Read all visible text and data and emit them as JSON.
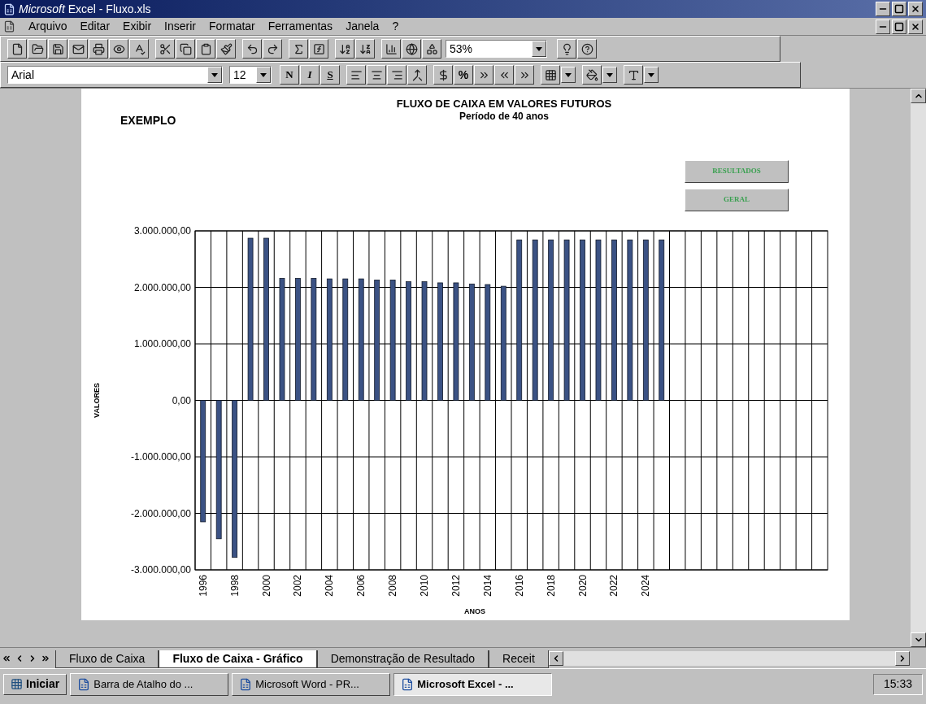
{
  "window": {
    "title": "*Microsoft* Excel - Fluxo.xls"
  },
  "menu": [
    "Arquivo",
    "Editar",
    "Exibir",
    "Inserir",
    "Formatar",
    "Ferramentas",
    "Janela",
    "?"
  ],
  "toolbar": {
    "zoom": "53%"
  },
  "format_toolbar": {
    "font": "Arial",
    "size": "12",
    "style_buttons": [
      "N",
      "I",
      "S"
    ],
    "percent": "%"
  },
  "chart": {
    "heading": "EXEMPLO",
    "buttons": [
      "RESULTADOS",
      "GERAL"
    ],
    "chart_data": {
      "type": "bar",
      "title": "FLUXO DE CAIXA EM VALORES FUTUROS",
      "subtitle": "Período de 40 anos",
      "xlabel": "ANOS",
      "ylabel": "VALORES",
      "x": [
        1996,
        1997,
        1998,
        1999,
        2000,
        2001,
        2002,
        2003,
        2004,
        2005,
        2006,
        2007,
        2008,
        2009,
        2010,
        2011,
        2012,
        2013,
        2014,
        2015,
        2016,
        2017,
        2018,
        2019,
        2020,
        2021,
        2022,
        2023,
        2024,
        2025
      ],
      "xlim": [
        1995.5,
        2035.5
      ],
      "grid": true,
      "series": [
        {
          "color": "#3b5284",
          "values": [
            -2150000,
            -2450000,
            -2780000,
            2870000,
            2870000,
            2160000,
            2160000,
            2160000,
            2150000,
            2150000,
            2150000,
            2130000,
            2130000,
            2100000,
            2100000,
            2080000,
            2080000,
            2060000,
            2050000,
            2020000,
            2840000,
            2840000,
            2840000,
            2840000,
            2840000,
            2840000,
            2840000,
            2840000,
            2840000,
            2840000
          ]
        }
      ],
      "ylim": [
        -3000000,
        3000000
      ],
      "yticks": [
        {
          "value": 3000000,
          "label": "3.000.000,00"
        },
        {
          "value": 2000000,
          "label": "2.000.000,00"
        },
        {
          "value": 1000000,
          "label": "1.000.000,00"
        },
        {
          "value": 0,
          "label": "0,00"
        },
        {
          "value": -1000000,
          "label": "-1.000.000,00"
        },
        {
          "value": -2000000,
          "label": "-2.000.000,00"
        },
        {
          "value": -3000000,
          "label": "-3.000.000,00"
        }
      ],
      "xticks": [
        1996,
        1998,
        2000,
        2002,
        2004,
        2006,
        2008,
        2010,
        2012,
        2014,
        2016,
        2018,
        2020,
        2022,
        2024
      ]
    }
  },
  "sheet_tabs": [
    {
      "label": "Fluxo de Caixa",
      "selected": false
    },
    {
      "label": "Fluxo de Caixa - Gráfico",
      "selected": true
    },
    {
      "label": "Demonstração de Resultado",
      "selected": false
    },
    {
      "label": "Receit",
      "selected": false
    }
  ],
  "taskbar": {
    "start": "Iniciar",
    "tasks": [
      {
        "label": "Barra de Atalho do ...",
        "selected": false
      },
      {
        "label": "Microsoft Word - PR...",
        "selected": false
      },
      {
        "label": "Microsoft Excel - ...",
        "selected": true
      }
    ],
    "clock": "15:33"
  }
}
